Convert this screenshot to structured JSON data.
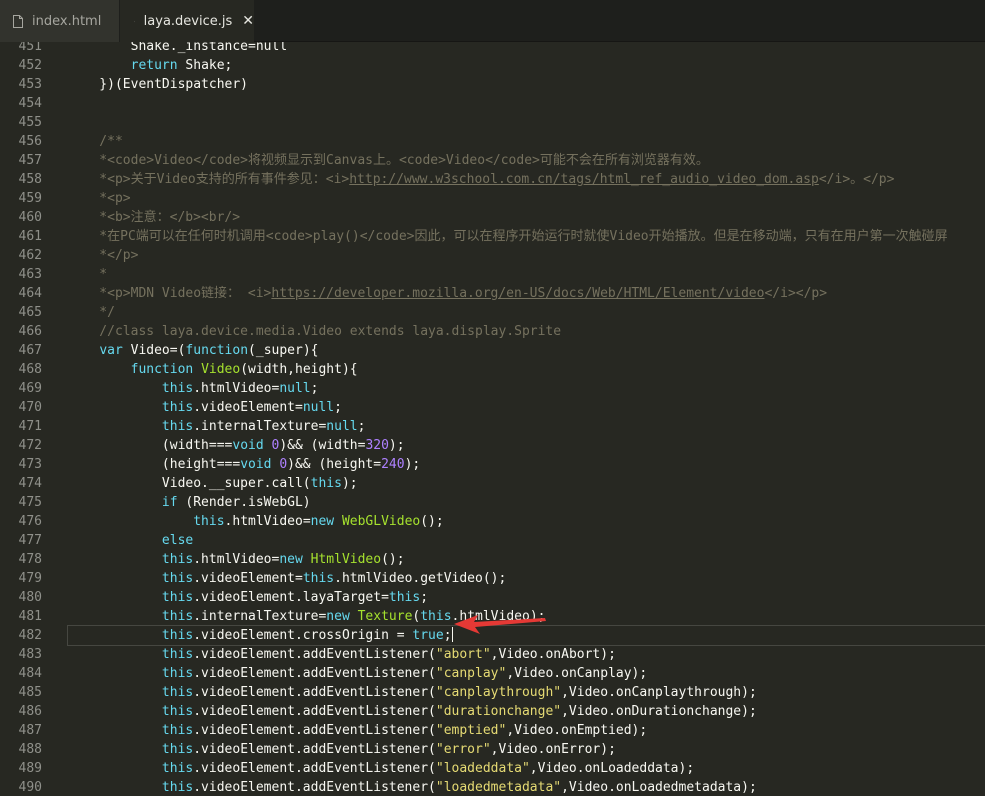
{
  "tabs": [
    {
      "label": "index.html",
      "active": false
    },
    {
      "label": "laya.device.js",
      "active": true
    }
  ],
  "colors": {
    "background": "#272822",
    "comment": "#75715e",
    "keyword": "#66d9ef",
    "function": "#a6e22e",
    "string": "#e6db74",
    "number": "#ae81ff",
    "annotation_arrow": "#e53935"
  },
  "editor": {
    "current_line_number": "482",
    "lines": [
      {
        "n": "451",
        "tokens": [
          {
            "t": "        Shake._instance=null",
            "c": ""
          }
        ]
      },
      {
        "n": "452",
        "tokens": [
          {
            "t": "        ",
            "c": ""
          },
          {
            "t": "return",
            "c": "keyword"
          },
          {
            "t": " Shake;",
            "c": ""
          }
        ]
      },
      {
        "n": "453",
        "tokens": [
          {
            "t": "    })(EventDispatcher)",
            "c": ""
          }
        ]
      },
      {
        "n": "454",
        "tokens": []
      },
      {
        "n": "455",
        "tokens": []
      },
      {
        "n": "456",
        "tokens": [
          {
            "t": "    /**",
            "c": "comment"
          }
        ]
      },
      {
        "n": "457",
        "tokens": [
          {
            "t": "    *<code>Video</code>将视频显示到Canvas上。<code>Video</code>可能不会在所有浏览器有效。",
            "c": "comment"
          }
        ]
      },
      {
        "n": "458",
        "tokens": [
          {
            "t": "    *<p>关于Video支持的所有事件参见：<i>",
            "c": "comment"
          },
          {
            "t": "http://www.w3school.com.cn/tags/html_ref_audio_video_dom.asp",
            "c": "comment link"
          },
          {
            "t": "</i>。</p>",
            "c": "comment"
          }
        ]
      },
      {
        "n": "459",
        "tokens": [
          {
            "t": "    *<p>",
            "c": "comment"
          }
        ]
      },
      {
        "n": "460",
        "tokens": [
          {
            "t": "    *<b>注意：</b><br/>",
            "c": "comment"
          }
        ]
      },
      {
        "n": "461",
        "tokens": [
          {
            "t": "    *在PC端可以在任何时机调用<code>play()</code>因此，可以在程序开始运行时就使Video开始播放。但是在移动端，只有在用户第一次触碰屏",
            "c": "comment"
          }
        ]
      },
      {
        "n": "462",
        "tokens": [
          {
            "t": "    *</p>",
            "c": "comment"
          }
        ]
      },
      {
        "n": "463",
        "tokens": [
          {
            "t": "    *",
            "c": "comment"
          }
        ]
      },
      {
        "n": "464",
        "tokens": [
          {
            "t": "    *<p>MDN Video链接： <i>",
            "c": "comment"
          },
          {
            "t": "https://developer.mozilla.org/en-US/docs/Web/HTML/Element/video",
            "c": "comment link"
          },
          {
            "t": "</i></p>",
            "c": "comment"
          }
        ]
      },
      {
        "n": "465",
        "tokens": [
          {
            "t": "    */",
            "c": "comment"
          }
        ]
      },
      {
        "n": "466",
        "tokens": [
          {
            "t": "    //class laya.device.media.Video extends laya.display.Sprite",
            "c": "comment"
          }
        ]
      },
      {
        "n": "467",
        "tokens": [
          {
            "t": "    ",
            "c": ""
          },
          {
            "t": "var",
            "c": "keyword"
          },
          {
            "t": " Video=(",
            "c": ""
          },
          {
            "t": "function",
            "c": "keyword"
          },
          {
            "t": "(_super){",
            "c": ""
          }
        ]
      },
      {
        "n": "468",
        "tokens": [
          {
            "t": "        ",
            "c": ""
          },
          {
            "t": "function",
            "c": "keyword"
          },
          {
            "t": " ",
            "c": ""
          },
          {
            "t": "Video",
            "c": "func"
          },
          {
            "t": "(width,height){",
            "c": ""
          }
        ]
      },
      {
        "n": "469",
        "tokens": [
          {
            "t": "            ",
            "c": ""
          },
          {
            "t": "this",
            "c": "keyword"
          },
          {
            "t": ".htmlVideo=",
            "c": ""
          },
          {
            "t": "null",
            "c": "keyword"
          },
          {
            "t": ";",
            "c": ""
          }
        ]
      },
      {
        "n": "470",
        "tokens": [
          {
            "t": "            ",
            "c": ""
          },
          {
            "t": "this",
            "c": "keyword"
          },
          {
            "t": ".videoElement=",
            "c": ""
          },
          {
            "t": "null",
            "c": "keyword"
          },
          {
            "t": ";",
            "c": ""
          }
        ]
      },
      {
        "n": "471",
        "tokens": [
          {
            "t": "            ",
            "c": ""
          },
          {
            "t": "this",
            "c": "keyword"
          },
          {
            "t": ".internalTexture=",
            "c": ""
          },
          {
            "t": "null",
            "c": "keyword"
          },
          {
            "t": ";",
            "c": ""
          }
        ]
      },
      {
        "n": "472",
        "tokens": [
          {
            "t": "            (width===",
            "c": ""
          },
          {
            "t": "void",
            "c": "keyword"
          },
          {
            "t": " ",
            "c": ""
          },
          {
            "t": "0",
            "c": "number"
          },
          {
            "t": ")&& (width=",
            "c": ""
          },
          {
            "t": "320",
            "c": "number"
          },
          {
            "t": ");",
            "c": ""
          }
        ]
      },
      {
        "n": "473",
        "tokens": [
          {
            "t": "            (height===",
            "c": ""
          },
          {
            "t": "void",
            "c": "keyword"
          },
          {
            "t": " ",
            "c": ""
          },
          {
            "t": "0",
            "c": "number"
          },
          {
            "t": ")&& (height=",
            "c": ""
          },
          {
            "t": "240",
            "c": "number"
          },
          {
            "t": ");",
            "c": ""
          }
        ]
      },
      {
        "n": "474",
        "tokens": [
          {
            "t": "            Video.__super.call(",
            "c": ""
          },
          {
            "t": "this",
            "c": "keyword"
          },
          {
            "t": ");",
            "c": ""
          }
        ]
      },
      {
        "n": "475",
        "tokens": [
          {
            "t": "            ",
            "c": ""
          },
          {
            "t": "if",
            "c": "keyword"
          },
          {
            "t": " (Render.isWebGL)",
            "c": ""
          }
        ]
      },
      {
        "n": "476",
        "tokens": [
          {
            "t": "                ",
            "c": ""
          },
          {
            "t": "this",
            "c": "keyword"
          },
          {
            "t": ".htmlVideo=",
            "c": ""
          },
          {
            "t": "new",
            "c": "keyword"
          },
          {
            "t": " ",
            "c": ""
          },
          {
            "t": "WebGLVideo",
            "c": "func"
          },
          {
            "t": "();",
            "c": ""
          }
        ]
      },
      {
        "n": "477",
        "tokens": [
          {
            "t": "            ",
            "c": ""
          },
          {
            "t": "else",
            "c": "keyword"
          }
        ]
      },
      {
        "n": "478",
        "tokens": [
          {
            "t": "            ",
            "c": ""
          },
          {
            "t": "this",
            "c": "keyword"
          },
          {
            "t": ".htmlVideo=",
            "c": ""
          },
          {
            "t": "new",
            "c": "keyword"
          },
          {
            "t": " ",
            "c": ""
          },
          {
            "t": "HtmlVideo",
            "c": "func"
          },
          {
            "t": "();",
            "c": ""
          }
        ]
      },
      {
        "n": "479",
        "tokens": [
          {
            "t": "            ",
            "c": ""
          },
          {
            "t": "this",
            "c": "keyword"
          },
          {
            "t": ".videoElement=",
            "c": ""
          },
          {
            "t": "this",
            "c": "keyword"
          },
          {
            "t": ".htmlVideo.getVideo();",
            "c": ""
          }
        ]
      },
      {
        "n": "480",
        "tokens": [
          {
            "t": "            ",
            "c": ""
          },
          {
            "t": "this",
            "c": "keyword"
          },
          {
            "t": ".videoElement.layaTarget=",
            "c": ""
          },
          {
            "t": "this",
            "c": "keyword"
          },
          {
            "t": ";",
            "c": ""
          }
        ]
      },
      {
        "n": "481",
        "tokens": [
          {
            "t": "            ",
            "c": ""
          },
          {
            "t": "this",
            "c": "keyword"
          },
          {
            "t": ".internalTexture=",
            "c": ""
          },
          {
            "t": "new",
            "c": "keyword"
          },
          {
            "t": " ",
            "c": ""
          },
          {
            "t": "Texture",
            "c": "func"
          },
          {
            "t": "(",
            "c": ""
          },
          {
            "t": "this",
            "c": "keyword"
          },
          {
            "t": ".htmlVideo);",
            "c": ""
          }
        ]
      },
      {
        "n": "482",
        "tokens": [
          {
            "t": "            ",
            "c": ""
          },
          {
            "t": "this",
            "c": "keyword"
          },
          {
            "t": ".videoElement.crossOrigin = ",
            "c": ""
          },
          {
            "t": "true",
            "c": "keyword"
          },
          {
            "t": ";",
            "c": ""
          }
        ]
      },
      {
        "n": "483",
        "tokens": [
          {
            "t": "            ",
            "c": ""
          },
          {
            "t": "this",
            "c": "keyword"
          },
          {
            "t": ".videoElement.addEventListener(",
            "c": ""
          },
          {
            "t": "\"abort\"",
            "c": "string"
          },
          {
            "t": ",Video.onAbort);",
            "c": ""
          }
        ]
      },
      {
        "n": "484",
        "tokens": [
          {
            "t": "            ",
            "c": ""
          },
          {
            "t": "this",
            "c": "keyword"
          },
          {
            "t": ".videoElement.addEventListener(",
            "c": ""
          },
          {
            "t": "\"canplay\"",
            "c": "string"
          },
          {
            "t": ",Video.onCanplay);",
            "c": ""
          }
        ]
      },
      {
        "n": "485",
        "tokens": [
          {
            "t": "            ",
            "c": ""
          },
          {
            "t": "this",
            "c": "keyword"
          },
          {
            "t": ".videoElement.addEventListener(",
            "c": ""
          },
          {
            "t": "\"canplaythrough\"",
            "c": "string"
          },
          {
            "t": ",Video.onCanplaythrough);",
            "c": ""
          }
        ]
      },
      {
        "n": "486",
        "tokens": [
          {
            "t": "            ",
            "c": ""
          },
          {
            "t": "this",
            "c": "keyword"
          },
          {
            "t": ".videoElement.addEventListener(",
            "c": ""
          },
          {
            "t": "\"durationchange\"",
            "c": "string"
          },
          {
            "t": ",Video.onDurationchange);",
            "c": ""
          }
        ]
      },
      {
        "n": "487",
        "tokens": [
          {
            "t": "            ",
            "c": ""
          },
          {
            "t": "this",
            "c": "keyword"
          },
          {
            "t": ".videoElement.addEventListener(",
            "c": ""
          },
          {
            "t": "\"emptied\"",
            "c": "string"
          },
          {
            "t": ",Video.onEmptied);",
            "c": ""
          }
        ]
      },
      {
        "n": "488",
        "tokens": [
          {
            "t": "            ",
            "c": ""
          },
          {
            "t": "this",
            "c": "keyword"
          },
          {
            "t": ".videoElement.addEventListener(",
            "c": ""
          },
          {
            "t": "\"error\"",
            "c": "string"
          },
          {
            "t": ",Video.onError);",
            "c": ""
          }
        ]
      },
      {
        "n": "489",
        "tokens": [
          {
            "t": "            ",
            "c": ""
          },
          {
            "t": "this",
            "c": "keyword"
          },
          {
            "t": ".videoElement.addEventListener(",
            "c": ""
          },
          {
            "t": "\"loadeddata\"",
            "c": "string"
          },
          {
            "t": ",Video.onLoadeddata);",
            "c": ""
          }
        ]
      },
      {
        "n": "490",
        "tokens": [
          {
            "t": "            ",
            "c": ""
          },
          {
            "t": "this",
            "c": "keyword"
          },
          {
            "t": ".videoElement.addEventListener(",
            "c": ""
          },
          {
            "t": "\"loadedmetadata\"",
            "c": "string"
          },
          {
            "t": ",Video.onLoadedmetadata);",
            "c": ""
          }
        ]
      }
    ]
  }
}
